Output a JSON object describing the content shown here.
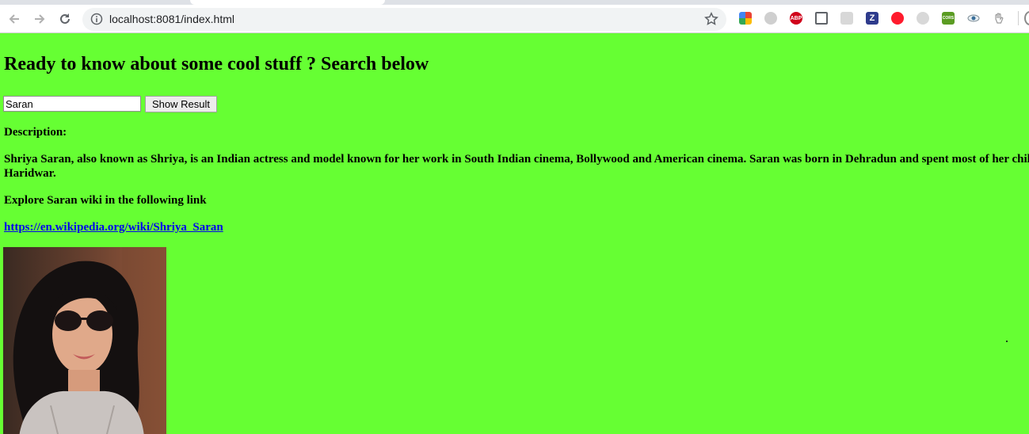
{
  "browser": {
    "url": "localhost:8081/index.html"
  },
  "extensions": [
    {
      "name": "google-photos-extension-icon",
      "label": ""
    },
    {
      "name": "puzzle-extension-icon",
      "label": ""
    },
    {
      "name": "adblock-plus-icon",
      "label": "ABP"
    },
    {
      "name": "cast-icon",
      "label": ""
    },
    {
      "name": "pdf-extension-icon",
      "label": ""
    },
    {
      "name": "zotero-extension-icon",
      "label": "Z"
    },
    {
      "name": "opera-extension-icon",
      "label": ""
    },
    {
      "name": "moon-extension-icon",
      "label": ""
    },
    {
      "name": "cors-extension-icon",
      "label": "CORS"
    },
    {
      "name": "eye-extension-icon",
      "label": ""
    },
    {
      "name": "hand-extension-icon",
      "label": ""
    }
  ],
  "page": {
    "title": "Ready to know about some cool stuff ? Search below",
    "search": {
      "value": "Saran",
      "button_label": "Show Result"
    },
    "description_label": "Description:",
    "description_text": "Shriya Saran, also known as Shriya, is an Indian actress and model known for her work in South Indian cinema, Bollywood and American cinema. Saran was born in Dehradun and spent most of her childhood in Haridwar.",
    "explore_text": "Explore Saran wiki in the following link",
    "wiki_link": "https://en.wikipedia.org/wiki/Shriya_Saran"
  },
  "colors": {
    "page_background": "#66ff33",
    "link": "#0000ee"
  }
}
